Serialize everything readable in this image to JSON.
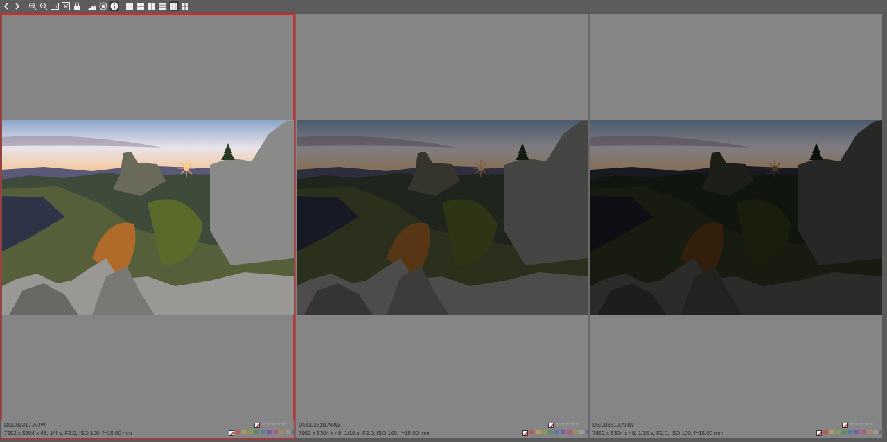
{
  "toolbar": {
    "buttons": [
      {
        "name": "back-icon"
      },
      {
        "name": "forward-icon"
      },
      {
        "name": "zoom-in-icon"
      },
      {
        "name": "zoom-out-icon"
      },
      {
        "name": "zoom-1-1-icon",
        "text": "1:1"
      },
      {
        "name": "fit-icon"
      },
      {
        "name": "lock-icon"
      },
      {
        "name": "histogram-icon"
      },
      {
        "name": "focus-icon"
      },
      {
        "name": "info-icon",
        "active": true
      },
      {
        "name": "layout-single-icon"
      },
      {
        "name": "layout-two-rows-icon"
      },
      {
        "name": "layout-two-cols-icon"
      },
      {
        "name": "layout-three-rows-icon"
      },
      {
        "name": "layout-three-cols-icon",
        "active": true
      },
      {
        "name": "layout-grid-icon"
      }
    ]
  },
  "panels": [
    {
      "filename": "DSC03317.ARW",
      "meta": "7952 x 5304 x 48, 1/4 s, F2.0, ISO 100, f=15.00 mm",
      "rating": 0,
      "selected": true,
      "brightness": 1.0
    },
    {
      "filename": "DSC03318.ARW",
      "meta": "7952 x 5304 x 48, 1/10 s, F2.0, ISO 100, f=15.00 mm",
      "rating": 0,
      "selected": false,
      "brightness": 0.5
    },
    {
      "filename": "DSC03319.ARW",
      "meta": "7952 x 5304 x 48, 1/25 s, F2.0, ISO 100, f=15.00 mm",
      "rating": 0,
      "selected": false,
      "brightness": 0.28
    }
  ],
  "color_labels": [
    "#b35a5a",
    "#b39a5a",
    "#8a9a5a",
    "#5a8a6a",
    "#5a7aa8",
    "#7a5aa8",
    "#a85a8a",
    "#a88a5a",
    "#9a9a9a",
    "#6a6a6a"
  ],
  "star_glyph": "★★★★★"
}
